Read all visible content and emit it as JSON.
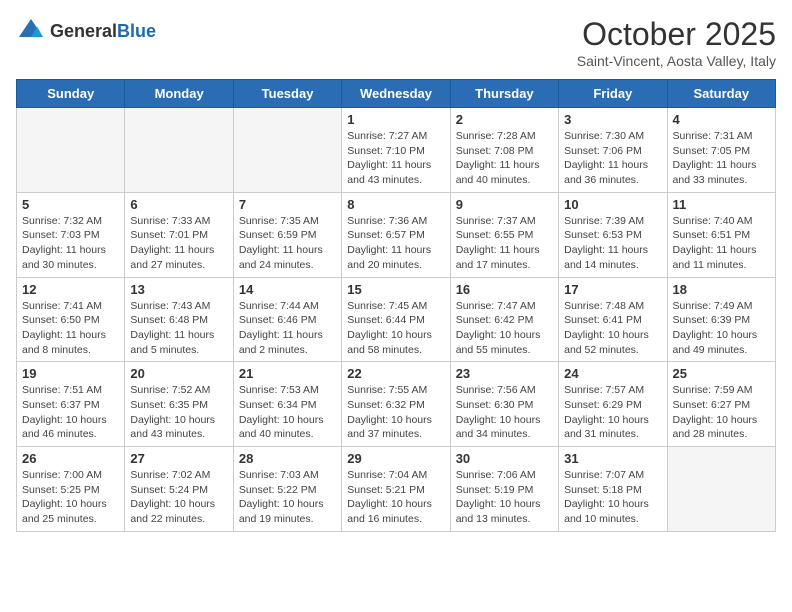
{
  "header": {
    "logo_general": "General",
    "logo_blue": "Blue",
    "title": "October 2025",
    "subtitle": "Saint-Vincent, Aosta Valley, Italy"
  },
  "weekdays": [
    "Sunday",
    "Monday",
    "Tuesday",
    "Wednesday",
    "Thursday",
    "Friday",
    "Saturday"
  ],
  "weeks": [
    [
      {
        "day": "",
        "detail": ""
      },
      {
        "day": "",
        "detail": ""
      },
      {
        "day": "",
        "detail": ""
      },
      {
        "day": "1",
        "detail": "Sunrise: 7:27 AM\nSunset: 7:10 PM\nDaylight: 11 hours and 43 minutes."
      },
      {
        "day": "2",
        "detail": "Sunrise: 7:28 AM\nSunset: 7:08 PM\nDaylight: 11 hours and 40 minutes."
      },
      {
        "day": "3",
        "detail": "Sunrise: 7:30 AM\nSunset: 7:06 PM\nDaylight: 11 hours and 36 minutes."
      },
      {
        "day": "4",
        "detail": "Sunrise: 7:31 AM\nSunset: 7:05 PM\nDaylight: 11 hours and 33 minutes."
      }
    ],
    [
      {
        "day": "5",
        "detail": "Sunrise: 7:32 AM\nSunset: 7:03 PM\nDaylight: 11 hours and 30 minutes."
      },
      {
        "day": "6",
        "detail": "Sunrise: 7:33 AM\nSunset: 7:01 PM\nDaylight: 11 hours and 27 minutes."
      },
      {
        "day": "7",
        "detail": "Sunrise: 7:35 AM\nSunset: 6:59 PM\nDaylight: 11 hours and 24 minutes."
      },
      {
        "day": "8",
        "detail": "Sunrise: 7:36 AM\nSunset: 6:57 PM\nDaylight: 11 hours and 20 minutes."
      },
      {
        "day": "9",
        "detail": "Sunrise: 7:37 AM\nSunset: 6:55 PM\nDaylight: 11 hours and 17 minutes."
      },
      {
        "day": "10",
        "detail": "Sunrise: 7:39 AM\nSunset: 6:53 PM\nDaylight: 11 hours and 14 minutes."
      },
      {
        "day": "11",
        "detail": "Sunrise: 7:40 AM\nSunset: 6:51 PM\nDaylight: 11 hours and 11 minutes."
      }
    ],
    [
      {
        "day": "12",
        "detail": "Sunrise: 7:41 AM\nSunset: 6:50 PM\nDaylight: 11 hours and 8 minutes."
      },
      {
        "day": "13",
        "detail": "Sunrise: 7:43 AM\nSunset: 6:48 PM\nDaylight: 11 hours and 5 minutes."
      },
      {
        "day": "14",
        "detail": "Sunrise: 7:44 AM\nSunset: 6:46 PM\nDaylight: 11 hours and 2 minutes."
      },
      {
        "day": "15",
        "detail": "Sunrise: 7:45 AM\nSunset: 6:44 PM\nDaylight: 10 hours and 58 minutes."
      },
      {
        "day": "16",
        "detail": "Sunrise: 7:47 AM\nSunset: 6:42 PM\nDaylight: 10 hours and 55 minutes."
      },
      {
        "day": "17",
        "detail": "Sunrise: 7:48 AM\nSunset: 6:41 PM\nDaylight: 10 hours and 52 minutes."
      },
      {
        "day": "18",
        "detail": "Sunrise: 7:49 AM\nSunset: 6:39 PM\nDaylight: 10 hours and 49 minutes."
      }
    ],
    [
      {
        "day": "19",
        "detail": "Sunrise: 7:51 AM\nSunset: 6:37 PM\nDaylight: 10 hours and 46 minutes."
      },
      {
        "day": "20",
        "detail": "Sunrise: 7:52 AM\nSunset: 6:35 PM\nDaylight: 10 hours and 43 minutes."
      },
      {
        "day": "21",
        "detail": "Sunrise: 7:53 AM\nSunset: 6:34 PM\nDaylight: 10 hours and 40 minutes."
      },
      {
        "day": "22",
        "detail": "Sunrise: 7:55 AM\nSunset: 6:32 PM\nDaylight: 10 hours and 37 minutes."
      },
      {
        "day": "23",
        "detail": "Sunrise: 7:56 AM\nSunset: 6:30 PM\nDaylight: 10 hours and 34 minutes."
      },
      {
        "day": "24",
        "detail": "Sunrise: 7:57 AM\nSunset: 6:29 PM\nDaylight: 10 hours and 31 minutes."
      },
      {
        "day": "25",
        "detail": "Sunrise: 7:59 AM\nSunset: 6:27 PM\nDaylight: 10 hours and 28 minutes."
      }
    ],
    [
      {
        "day": "26",
        "detail": "Sunrise: 7:00 AM\nSunset: 5:25 PM\nDaylight: 10 hours and 25 minutes."
      },
      {
        "day": "27",
        "detail": "Sunrise: 7:02 AM\nSunset: 5:24 PM\nDaylight: 10 hours and 22 minutes."
      },
      {
        "day": "28",
        "detail": "Sunrise: 7:03 AM\nSunset: 5:22 PM\nDaylight: 10 hours and 19 minutes."
      },
      {
        "day": "29",
        "detail": "Sunrise: 7:04 AM\nSunset: 5:21 PM\nDaylight: 10 hours and 16 minutes."
      },
      {
        "day": "30",
        "detail": "Sunrise: 7:06 AM\nSunset: 5:19 PM\nDaylight: 10 hours and 13 minutes."
      },
      {
        "day": "31",
        "detail": "Sunrise: 7:07 AM\nSunset: 5:18 PM\nDaylight: 10 hours and 10 minutes."
      },
      {
        "day": "",
        "detail": ""
      }
    ]
  ]
}
